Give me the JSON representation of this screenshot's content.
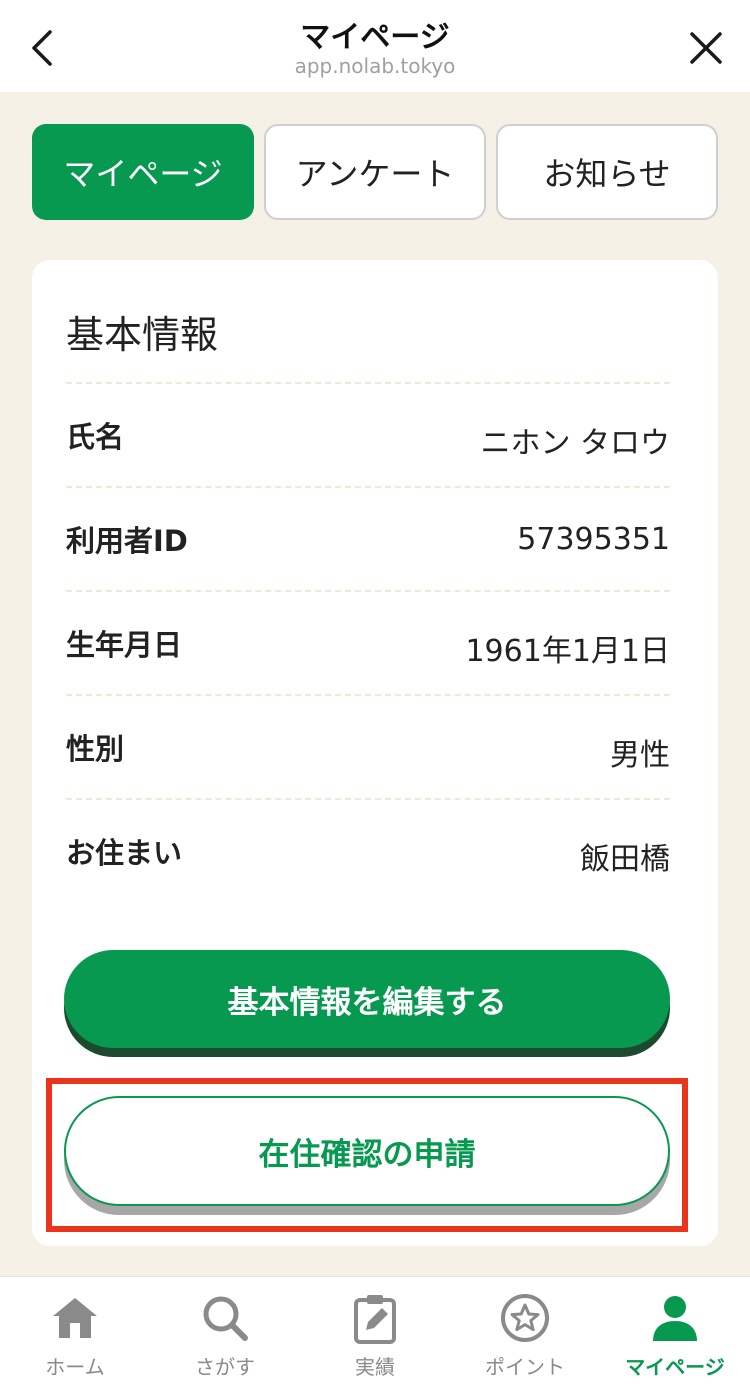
{
  "header": {
    "title": "マイページ",
    "url": "app.nolab.tokyo"
  },
  "tabs": [
    {
      "label": "マイページ",
      "active": true
    },
    {
      "label": "アンケート",
      "active": false
    },
    {
      "label": "お知らせ",
      "active": false
    }
  ],
  "profile": {
    "title": "基本情報",
    "rows": [
      {
        "label": "氏名",
        "value": "ニホン タロウ"
      },
      {
        "label": "利用者ID",
        "value": "57395351"
      },
      {
        "label": "生年月日",
        "value": "1961年1月1日"
      },
      {
        "label": "性別",
        "value": "男性"
      },
      {
        "label": "お住まい",
        "value": "飯田橋"
      }
    ],
    "edit_label": "基本情報を編集する",
    "residence_label": "在住確認の申請"
  },
  "nav": [
    {
      "label": "ホーム",
      "icon": "home-icon",
      "active": false
    },
    {
      "label": "さがす",
      "icon": "search-icon",
      "active": false
    },
    {
      "label": "実績",
      "icon": "clipboard-edit-icon",
      "active": false
    },
    {
      "label": "ポイント",
      "icon": "star-circle-icon",
      "active": false
    },
    {
      "label": "マイページ",
      "icon": "person-icon",
      "active": true
    }
  ],
  "colors": {
    "accent": "#06994f",
    "background": "#f5f1e6",
    "highlight": "#e8351c"
  }
}
